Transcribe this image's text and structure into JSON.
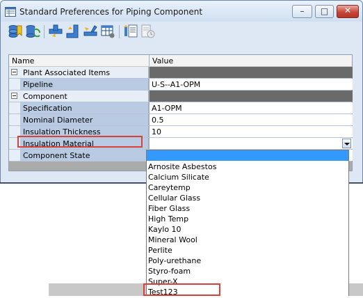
{
  "window": {
    "title": "Standard Preferences for Piping Component"
  },
  "title_buttons": {
    "minimize": "–",
    "maximize": "□",
    "close": "✕"
  },
  "grid": {
    "header": {
      "name": "Name",
      "value": "Value"
    },
    "rows": [
      {
        "name": "Plant Associated Items",
        "value": ""
      },
      {
        "name": "Pipeline",
        "value": "U-S--A1-OPM"
      },
      {
        "name": "Component",
        "value": ""
      },
      {
        "name": "Specification",
        "value": "A1-OPM"
      },
      {
        "name": "Nominal Diameter",
        "value": "0.5"
      },
      {
        "name": "Insulation Thickness",
        "value": "10"
      },
      {
        "name": "Insulation Material",
        "value": ""
      },
      {
        "name": "Component State",
        "value": ""
      }
    ]
  },
  "dropdown": {
    "options": [
      "Arnosite Asbestos",
      "Calcium Silicate",
      "Careytemp",
      "Cellular Glass",
      "Fiber Glass",
      "High Temp",
      "Kaylo 10",
      "Mineral Wool",
      "Perlite",
      "Poly-urethane",
      "Styro-foam",
      "Super-X",
      "Test123"
    ]
  },
  "colors": {
    "selection": "#3399ff",
    "highlight": "#d9413d",
    "category_value": "#6a6a6a",
    "property_name_bg": "#b8cbe2"
  }
}
